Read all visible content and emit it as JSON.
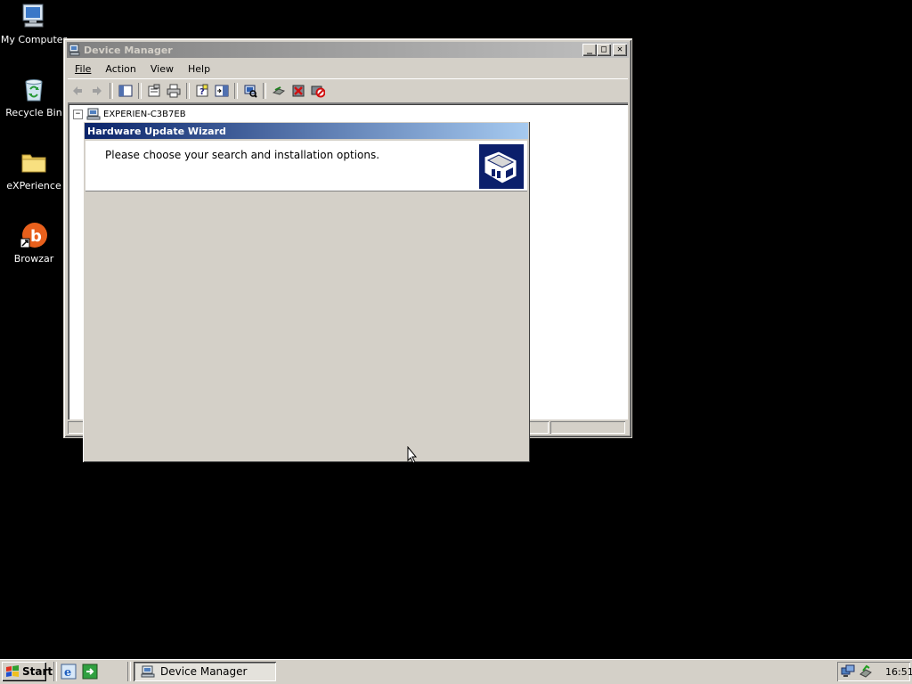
{
  "desktop": {
    "icons": [
      {
        "label": "My Computer",
        "icon": "my-computer-icon"
      },
      {
        "label": "Recycle Bin",
        "icon": "recycle-bin-icon"
      },
      {
        "label": "eXPerience",
        "icon": "folder-icon"
      },
      {
        "label": "Browzar",
        "icon": "browzar-icon"
      }
    ]
  },
  "device_manager": {
    "title": "Device Manager",
    "menu": [
      "File",
      "Action",
      "View",
      "Help"
    ],
    "toolbar_icons": [
      "back-icon",
      "forward-icon",
      "show-hide-tree-icon",
      "properties-icon",
      "print-icon",
      "help-icon",
      "export-list-icon",
      "scan-hardware-icon",
      "update-driver-icon",
      "uninstall-icon",
      "disable-icon"
    ],
    "tree_root": "EXPERIEN-C3B7EB",
    "tree_expander": "−"
  },
  "wizard": {
    "title": "Hardware Update Wizard",
    "heading": "Please choose your search and installation options."
  },
  "taskbar": {
    "start_label": "Start",
    "task_label": "Device Manager",
    "clock": "16:51"
  },
  "colors": {
    "desktop": "#000000",
    "face": "#d4d0c8",
    "active_title": "#0a246a",
    "inactive_title": "#808080"
  }
}
